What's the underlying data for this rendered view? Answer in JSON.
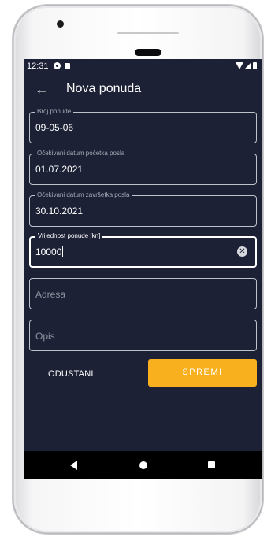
{
  "status_bar": {
    "time": "12:31",
    "left_icons": [
      "app-notification-icon",
      "sd-card-icon"
    ],
    "right_icons": [
      "wifi-icon",
      "signal-icon",
      "battery-icon"
    ]
  },
  "app_bar": {
    "back_icon": "arrow-left-icon",
    "back_glyph": "←",
    "title": "Nova ponuda"
  },
  "form": {
    "fields": [
      {
        "label": "Broj ponude",
        "value": "09-05-06"
      },
      {
        "label": "Očekivani datum početka posla",
        "value": "01.07.2021"
      },
      {
        "label": "Očekivani datum završetka posla",
        "value": "30.10.2021"
      },
      {
        "label": "Vrijednost ponude [kn]",
        "value": "10000",
        "focused": true,
        "clear_icon": "clear-icon",
        "clear_glyph": "✕"
      },
      {
        "placeholder": "Adresa",
        "value": ""
      },
      {
        "placeholder": "Opis",
        "value": ""
      }
    ]
  },
  "actions": {
    "cancel_label": "ODUSTANI",
    "save_label": "SPREMI"
  },
  "nav_bar": {
    "icons": [
      "nav-back-icon",
      "nav-home-icon",
      "nav-recents-icon"
    ]
  },
  "colors": {
    "screen_background": "#1c2135",
    "accent": "#f8b01e",
    "text": "#ffffff",
    "outline": "#bfc2cc"
  }
}
